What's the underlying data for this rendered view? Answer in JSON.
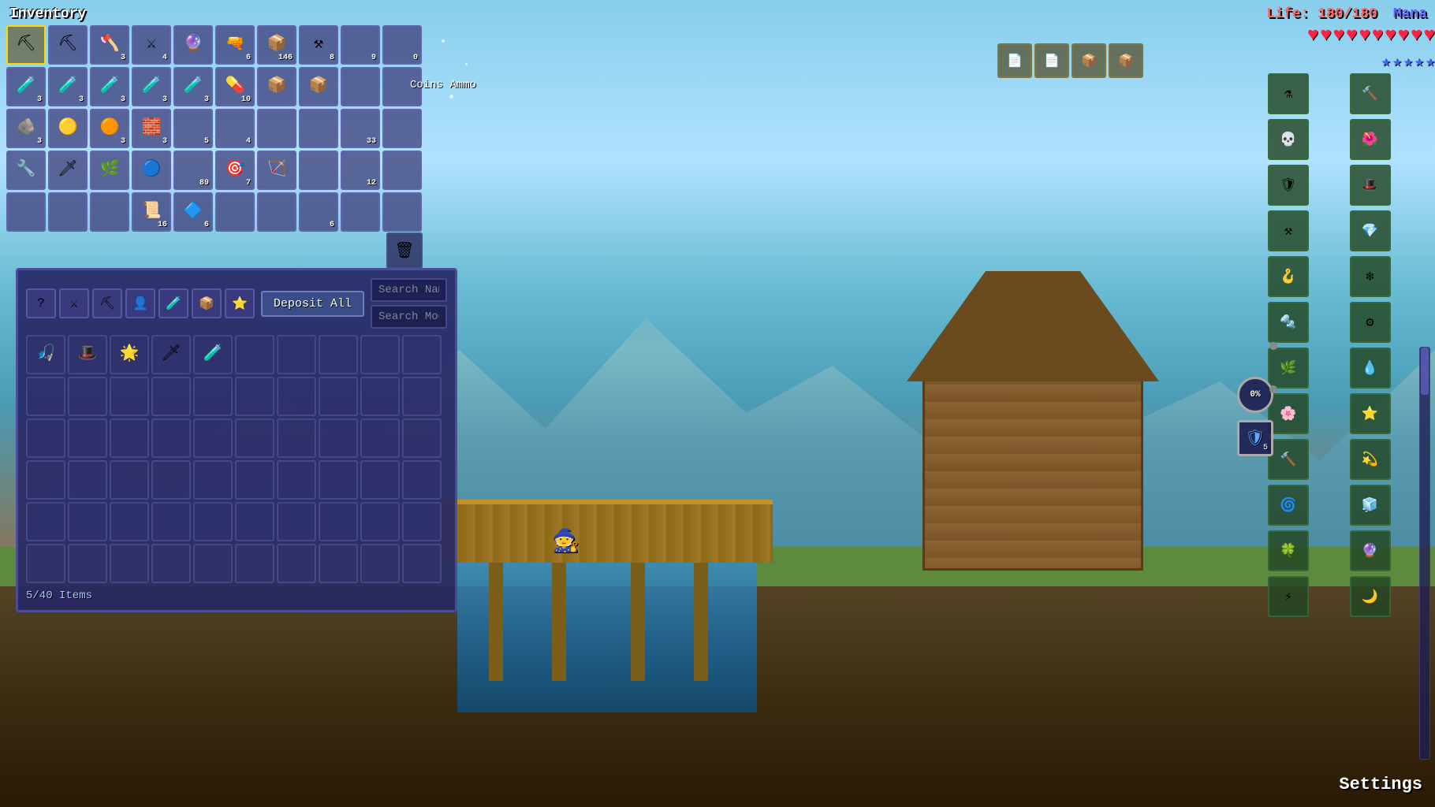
{
  "ui": {
    "inventory_label": "Inventory",
    "coins_ammo_label": "Coins  Ammo",
    "life_label": "Life: 180/180",
    "mana_label": "Mana",
    "settings_label": "Settings",
    "items_count": "5/40 Items",
    "deposit_all": "Deposit All",
    "search_name_placeholder": "Search Name",
    "search_mod_placeholder": "Search Mod",
    "hearts": [
      "♥",
      "♥",
      "♥",
      "♥",
      "♥",
      "♥",
      "♥",
      "♥",
      "♥",
      "♥"
    ],
    "stars": [
      "★",
      "★",
      "★",
      "★",
      "★"
    ]
  },
  "inventory": {
    "row1": [
      {
        "count": "",
        "icon": "⛏"
      },
      {
        "count": "",
        "icon": "⛏"
      },
      {
        "count": "3",
        "icon": "🪓"
      },
      {
        "count": "4",
        "icon": "⚔"
      },
      {
        "count": "",
        "icon": "🔮"
      },
      {
        "count": "6",
        "icon": "🔫"
      },
      {
        "count": "146",
        "icon": "📦"
      },
      {
        "count": "8",
        "icon": "⚒"
      },
      {
        "count": "9",
        "icon": ""
      },
      {
        "count": "0",
        "icon": ""
      }
    ],
    "row2": [
      {
        "count": "3",
        "icon": "🧪"
      },
      {
        "count": "3",
        "icon": "🧪"
      },
      {
        "count": "3",
        "icon": "🧪"
      },
      {
        "count": "3",
        "icon": "🧪"
      },
      {
        "count": "3",
        "icon": "🧪"
      },
      {
        "count": "10",
        "icon": "💊"
      },
      {
        "count": "",
        "icon": "📦"
      },
      {
        "count": "",
        "icon": "📦"
      },
      {
        "count": "",
        "icon": ""
      },
      {
        "count": "",
        "icon": ""
      }
    ],
    "row3": [
      {
        "count": "3",
        "icon": "🪨"
      },
      {
        "count": "",
        "icon": "🟡"
      },
      {
        "count": "3",
        "icon": "🟠"
      },
      {
        "count": "3",
        "icon": "🧱"
      },
      {
        "count": "5",
        "icon": ""
      },
      {
        "count": "4",
        "icon": ""
      },
      {
        "count": "",
        "icon": ""
      },
      {
        "count": "",
        "icon": ""
      },
      {
        "count": "33",
        "icon": ""
      },
      {
        "count": "",
        "icon": ""
      }
    ],
    "row4": [
      {
        "count": "",
        "icon": "🔧"
      },
      {
        "count": "",
        "icon": "🗡"
      },
      {
        "count": "",
        "icon": "🌿"
      },
      {
        "count": "",
        "icon": "🔵"
      },
      {
        "count": "89",
        "icon": ""
      },
      {
        "count": "7",
        "icon": "🎯"
      },
      {
        "count": "",
        "icon": "🏹"
      },
      {
        "count": "",
        "icon": ""
      },
      {
        "count": "12",
        "icon": ""
      },
      {
        "count": "",
        "icon": ""
      }
    ],
    "row5": [
      {
        "count": "",
        "icon": ""
      },
      {
        "count": "",
        "icon": ""
      },
      {
        "count": "",
        "icon": ""
      },
      {
        "count": "16",
        "icon": "📜"
      },
      {
        "count": "6",
        "icon": "🔷"
      },
      {
        "count": "",
        "icon": ""
      },
      {
        "count": "",
        "icon": ""
      },
      {
        "count": "6",
        "icon": ""
      },
      {
        "count": "",
        "icon": ""
      },
      {
        "count": "",
        "icon": ""
      }
    ]
  },
  "storage": {
    "filter_icons": [
      "?",
      "⚔",
      "⛏",
      "👤",
      "🧪",
      "📦",
      "⭐"
    ],
    "row1": [
      {
        "icon": "🎣",
        "count": ""
      },
      {
        "icon": "🎩",
        "count": ""
      },
      {
        "icon": "🌟",
        "count": ""
      },
      {
        "icon": "🗡",
        "count": ""
      },
      {
        "icon": "🧪",
        "count": ""
      },
      {
        "icon": "",
        "count": ""
      },
      {
        "icon": "",
        "count": ""
      },
      {
        "icon": "",
        "count": ""
      },
      {
        "icon": "",
        "count": ""
      },
      {
        "icon": "",
        "count": ""
      }
    ],
    "empty_rows": 5
  },
  "right_panel": {
    "slots": [
      {
        "icon": "⚗",
        "count": ""
      },
      {
        "icon": "🔨",
        "count": ""
      },
      {
        "icon": "💀",
        "count": ""
      },
      {
        "icon": "🌺",
        "count": ""
      },
      {
        "icon": "🛡",
        "count": ""
      },
      {
        "icon": "🎩",
        "count": ""
      },
      {
        "icon": "⚒",
        "count": ""
      },
      {
        "icon": "💎",
        "count": ""
      },
      {
        "icon": "🪝",
        "count": ""
      },
      {
        "icon": "❄",
        "count": ""
      },
      {
        "icon": "🔩",
        "count": ""
      },
      {
        "icon": "⚙",
        "count": ""
      },
      {
        "icon": "🌿",
        "count": ""
      },
      {
        "icon": "💧",
        "count": ""
      },
      {
        "icon": "🌸",
        "count": ""
      },
      {
        "icon": "⭐",
        "count": ""
      },
      {
        "icon": "🔨",
        "count": ""
      },
      {
        "icon": "💫",
        "count": ""
      },
      {
        "icon": "🌀",
        "count": ""
      },
      {
        "icon": "🧊",
        "count": ""
      },
      {
        "icon": "🍀",
        "count": ""
      },
      {
        "icon": "🔮",
        "count": ""
      },
      {
        "icon": "⚡",
        "count": ""
      },
      {
        "icon": "🌙",
        "count": ""
      }
    ]
  },
  "badges": {
    "percent": "0%",
    "shield_num": "5"
  }
}
